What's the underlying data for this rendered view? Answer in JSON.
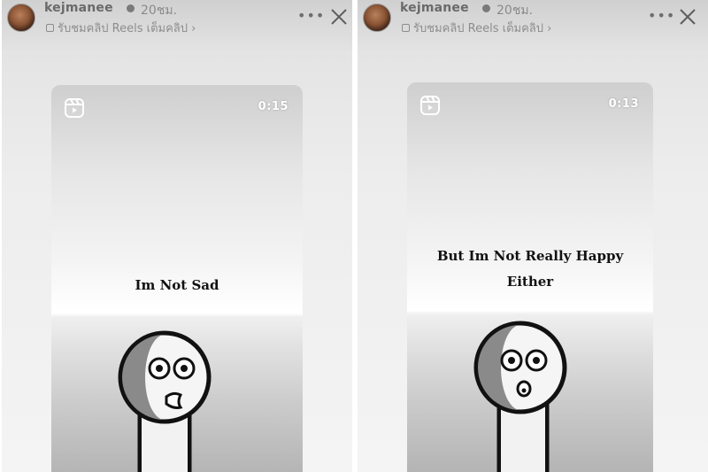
{
  "stories": [
    {
      "username": "kejmanee",
      "time_ago": "20ชม.",
      "subtitle": "รับชมคลิป Reels เต็มคลิป ›",
      "reel": {
        "duration": "0:15",
        "caption_lines": [
          "Im Not Sad"
        ]
      },
      "icons": [
        "avatar",
        "verified-badge-icon",
        "subtitle-clip-icon",
        "more-icon",
        "close-icon",
        "reels-icon"
      ]
    },
    {
      "username": "kejmanee",
      "time_ago": "20ชม.",
      "subtitle": "รับชมคลิป Reels เต็มคลิป ›",
      "reel": {
        "duration": "0:13",
        "caption_lines": [
          "But Im Not Really Happy",
          "Either"
        ]
      },
      "icons": [
        "avatar",
        "verified-badge-icon",
        "subtitle-clip-icon",
        "more-icon",
        "close-icon",
        "reels-icon"
      ]
    }
  ],
  "colors": {
    "header_text": "#6a6a6a",
    "caption_text": "#111111",
    "figure_outline": "#111111"
  }
}
